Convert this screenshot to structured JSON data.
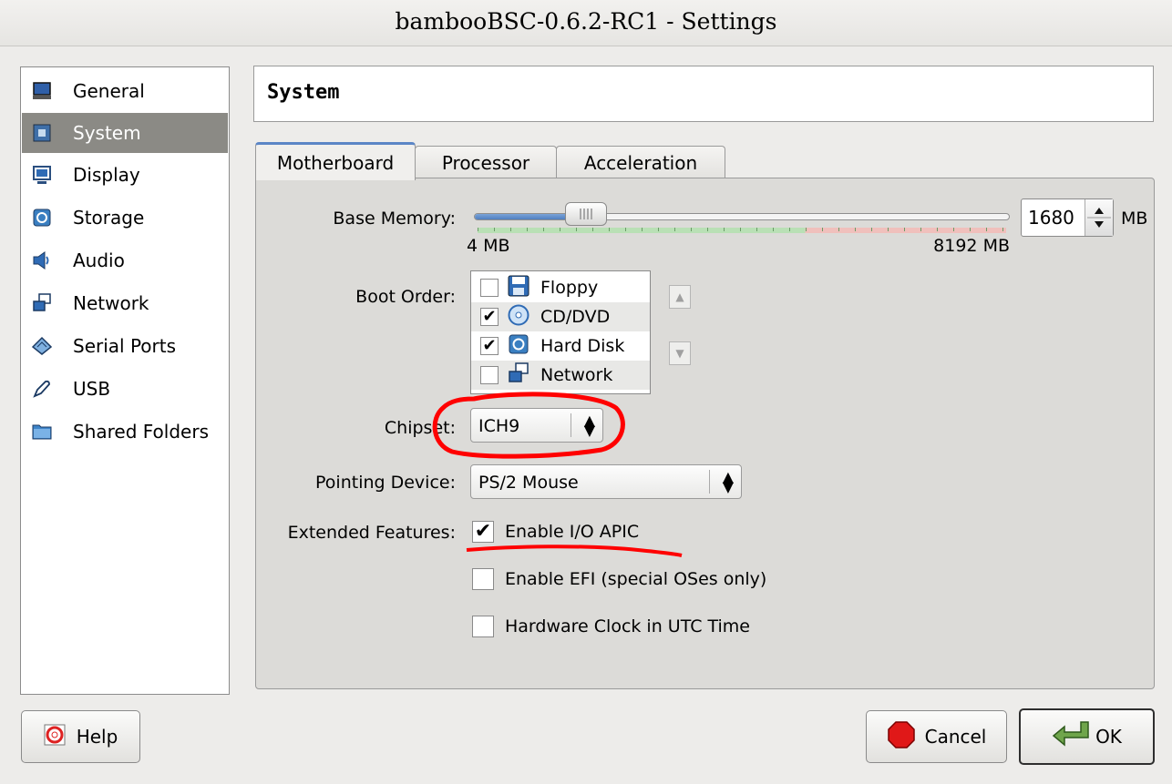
{
  "window": {
    "title": "bambooBSC-0.6.2-RC1 - Settings"
  },
  "sidebar": {
    "items": [
      {
        "label": "General",
        "icon": "monitor-icon"
      },
      {
        "label": "System",
        "icon": "chip-icon",
        "selected": true
      },
      {
        "label": "Display",
        "icon": "display-icon"
      },
      {
        "label": "Storage",
        "icon": "disk-icon"
      },
      {
        "label": "Audio",
        "icon": "speaker-icon"
      },
      {
        "label": "Network",
        "icon": "network-icon"
      },
      {
        "label": "Serial Ports",
        "icon": "serial-port-icon"
      },
      {
        "label": "USB",
        "icon": "usb-icon"
      },
      {
        "label": "Shared Folders",
        "icon": "folder-icon"
      }
    ]
  },
  "header": {
    "title": "System"
  },
  "tabs": [
    {
      "label": "Motherboard",
      "active": true
    },
    {
      "label": "Processor"
    },
    {
      "label": "Acceleration"
    }
  ],
  "motherboard": {
    "base_memory": {
      "label": "Base Memory:",
      "value": "1680",
      "unit": "MB",
      "min_label": "4 MB",
      "max_label": "8192 MB",
      "fraction": 0.205
    },
    "boot_order": {
      "label": "Boot Order:",
      "items": [
        {
          "label": "Floppy",
          "checked": false,
          "icon": "floppy-icon"
        },
        {
          "label": "CD/DVD",
          "checked": true,
          "icon": "cd-icon"
        },
        {
          "label": "Hard Disk",
          "checked": true,
          "icon": "hard-disk-icon"
        },
        {
          "label": "Network",
          "checked": false,
          "icon": "network-icon"
        }
      ]
    },
    "chipset": {
      "label": "Chipset:",
      "value": "ICH9"
    },
    "pointing_device": {
      "label": "Pointing Device:",
      "value": "PS/2 Mouse"
    },
    "extended_features": {
      "label": "Extended Features:",
      "items": [
        {
          "label": "Enable I/O APIC",
          "checked": true
        },
        {
          "label": "Enable EFI (special OSes only)",
          "checked": false
        },
        {
          "label": "Hardware Clock in UTC Time",
          "checked": false
        }
      ]
    }
  },
  "buttons": {
    "help": "Help",
    "cancel": "Cancel",
    "ok": "OK"
  },
  "colors": {
    "selection": "#8b8a85",
    "accent": "#5b86c6",
    "annotation": "#ff0000"
  }
}
